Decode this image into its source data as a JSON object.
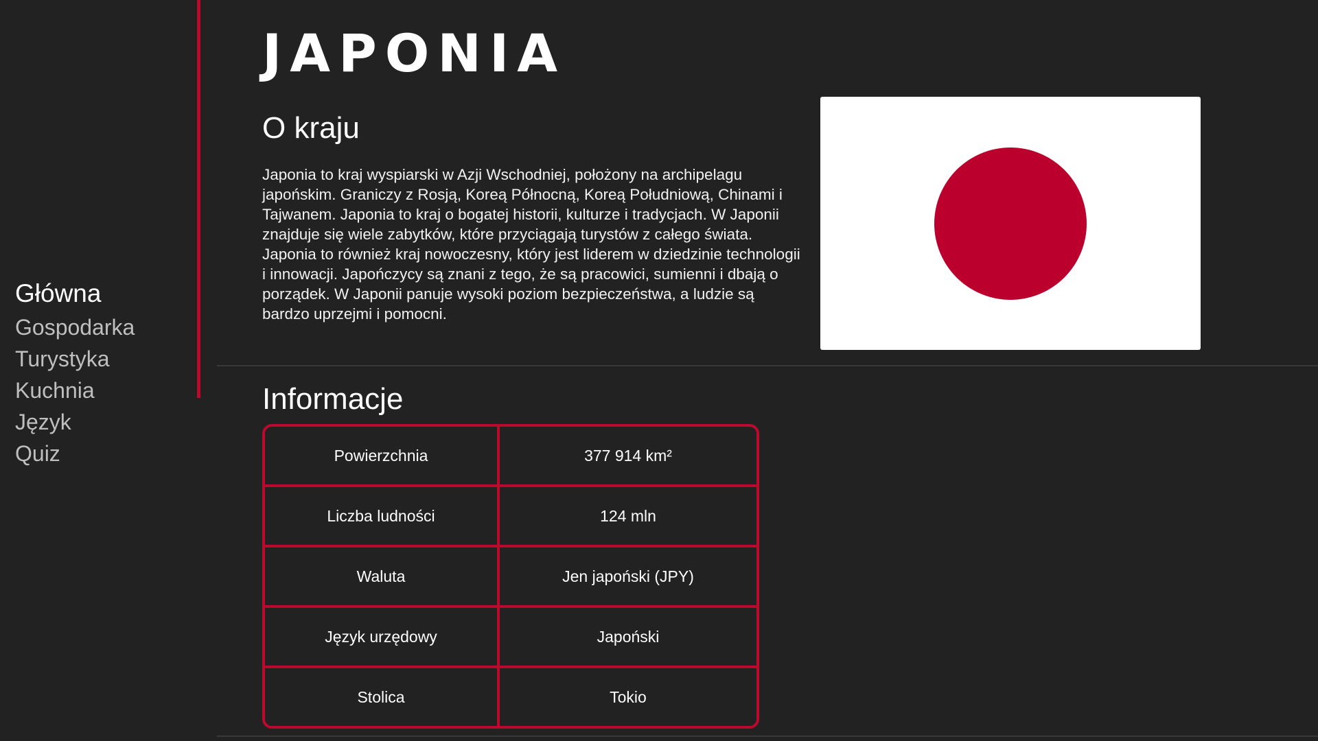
{
  "brand": {
    "logo_text": "JAPONIA",
    "accent_color": "#bc0a2c",
    "background_color": "#222223"
  },
  "nav": {
    "items": [
      {
        "label": "Główna",
        "active": true
      },
      {
        "label": "Gospodarka",
        "active": false
      },
      {
        "label": "Turystyka",
        "active": false
      },
      {
        "label": "Kuchnia",
        "active": false
      },
      {
        "label": "Język",
        "active": false
      },
      {
        "label": "Quiz",
        "active": false
      }
    ]
  },
  "about": {
    "title": "O kraju",
    "text": "Japonia to kraj wyspiarski w Azji Wschodniej, położony na archipelagu japońskim. Graniczy z Rosją, Koreą Północną, Koreą Południową, Chinami i Tajwanem. Japonia to kraj o bogatej historii, kulturze i tradycjach. W Japonii znajduje się wiele zabytków, które przyciągają turystów z całego świata. Japonia to również kraj nowoczesny, który jest liderem w dziedzinie technologii i innowacji. Japończycy są znani z tego, że są pracowici, sumienni i dbają o porządek. W Japonii panuje wysoki poziom bezpieczeństwa, a ludzie są bardzo uprzejmi i pomocni."
  },
  "flag": {
    "background_color": "#ffffff",
    "circle_color": "#bc002d"
  },
  "info": {
    "title": "Informacje",
    "rows": [
      {
        "key": "Powierzchnia",
        "value": "377 914 km²"
      },
      {
        "key": "Liczba ludności",
        "value": "124 mln"
      },
      {
        "key": "Waluta",
        "value": "Jen japoński (JPY)"
      },
      {
        "key": "Język urzędowy",
        "value": "Japoński"
      },
      {
        "key": "Stolica",
        "value": "Tokio"
      }
    ]
  }
}
